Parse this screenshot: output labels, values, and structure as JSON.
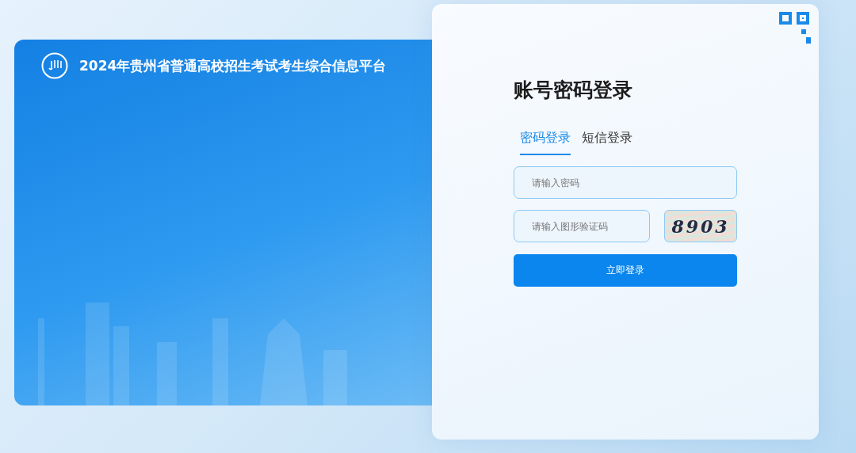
{
  "banner": {
    "title": "2024年贵州省普通高校招生考试考生综合信息平台"
  },
  "login": {
    "title": "账号密码登录",
    "tabs": [
      {
        "label": "密码登录",
        "selected": true
      },
      {
        "label": "短信登录",
        "selected": false
      }
    ],
    "password": {
      "placeholder": "请输入密码"
    },
    "captcha": {
      "placeholder": "请输入图形验证码",
      "image_text": "8903"
    },
    "submit": "立即登录"
  }
}
